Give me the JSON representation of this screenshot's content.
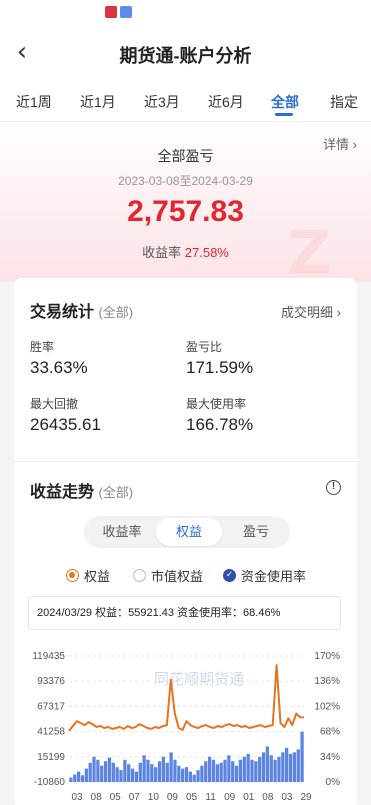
{
  "status_bar": {
    "icons": [
      "app-icon-red",
      "app-icon-blue"
    ]
  },
  "nav": {
    "title": "期货通-账户分析"
  },
  "tabs": [
    {
      "label": "近1周"
    },
    {
      "label": "近1月"
    },
    {
      "label": "近3月"
    },
    {
      "label": "近6月"
    },
    {
      "label": "全部",
      "active": true
    },
    {
      "label": "指定"
    }
  ],
  "summary": {
    "detail_link": "详情 ›",
    "label": "全部盈亏",
    "date_range": "2023-03-08至2024-03-29",
    "value": "2,757.83",
    "rate_label": "收益率",
    "rate_value": "27.58%"
  },
  "stats": {
    "title": "交易统计",
    "scope": "(全部)",
    "detail_link": "成交明细 ›",
    "items": [
      {
        "label": "胜率",
        "value": "33.63%"
      },
      {
        "label": "盈亏比",
        "value": "171.59%"
      },
      {
        "label": "最大回撤",
        "value": "26435.61"
      },
      {
        "label": "最大使用率",
        "value": "166.78%"
      }
    ]
  },
  "trend": {
    "title": "收益走势",
    "scope": "(全部)",
    "info_icon": "info-icon",
    "segments": [
      {
        "label": "收益率"
      },
      {
        "label": "权益",
        "active": true
      },
      {
        "label": "盈亏"
      }
    ],
    "legend": [
      {
        "label": "权益",
        "state": "on"
      },
      {
        "label": "市值权益",
        "state": "off"
      },
      {
        "label": "资金使用率",
        "state": "checked"
      }
    ],
    "tooltip": "2024/03/29  权益：55921.43  资金使用率：68.46%",
    "watermark": "同花顺期货通"
  },
  "colors": {
    "accent": "#2c6cd6",
    "profit": "#e0262f",
    "equity_line": "#e8731f",
    "usage_bar": "#3f6fe0"
  },
  "chart_data": {
    "type": "line",
    "x_ticks": [
      "03",
      "08",
      "05",
      "07",
      "10",
      "09",
      "05",
      "11",
      "09",
      "01",
      "08",
      "03",
      "29"
    ],
    "y_left_ticks": [
      "119435",
      "93376",
      "67317",
      "41258",
      "15199",
      "-10860"
    ],
    "y_right_ticks": [
      "170%",
      "136%",
      "102%",
      "68%",
      "34%",
      "0%"
    ],
    "ylim_left": [
      -10860,
      119435
    ],
    "ylim_right": [
      0,
      170
    ],
    "series": [
      {
        "name": "权益",
        "axis": "left",
        "values": [
          42000,
          47000,
          52000,
          50000,
          48000,
          51000,
          49000,
          46000,
          47000,
          45000,
          46000,
          44000,
          45000,
          46000,
          44000,
          47000,
          45000,
          46000,
          49000,
          47000,
          45000,
          44000,
          46000,
          45000,
          47000,
          48000,
          95000,
          60000,
          45000,
          43000,
          52000,
          48000,
          46000,
          45000,
          47000,
          48000,
          46000,
          45000,
          47000,
          46000,
          48000,
          49000,
          47000,
          48000,
          46000,
          47000,
          45000,
          46000,
          47000,
          48000,
          46000,
          47000,
          48000,
          110000,
          50000,
          46000,
          55000,
          48000,
          60000,
          56000,
          55921
        ]
      },
      {
        "name": "资金使用率",
        "axis": "right",
        "type": "bar",
        "values": [
          6,
          10,
          14,
          9,
          18,
          26,
          34,
          30,
          22,
          28,
          33,
          26,
          20,
          16,
          30,
          24,
          18,
          14,
          26,
          36,
          30,
          24,
          20,
          28,
          34,
          26,
          40,
          30,
          22,
          18,
          20,
          14,
          10,
          16,
          22,
          28,
          34,
          30,
          24,
          26,
          30,
          36,
          28,
          22,
          30,
          34,
          38,
          30,
          28,
          34,
          40,
          48,
          36,
          30,
          34,
          40,
          46,
          38,
          40,
          44,
          68
        ]
      }
    ]
  }
}
